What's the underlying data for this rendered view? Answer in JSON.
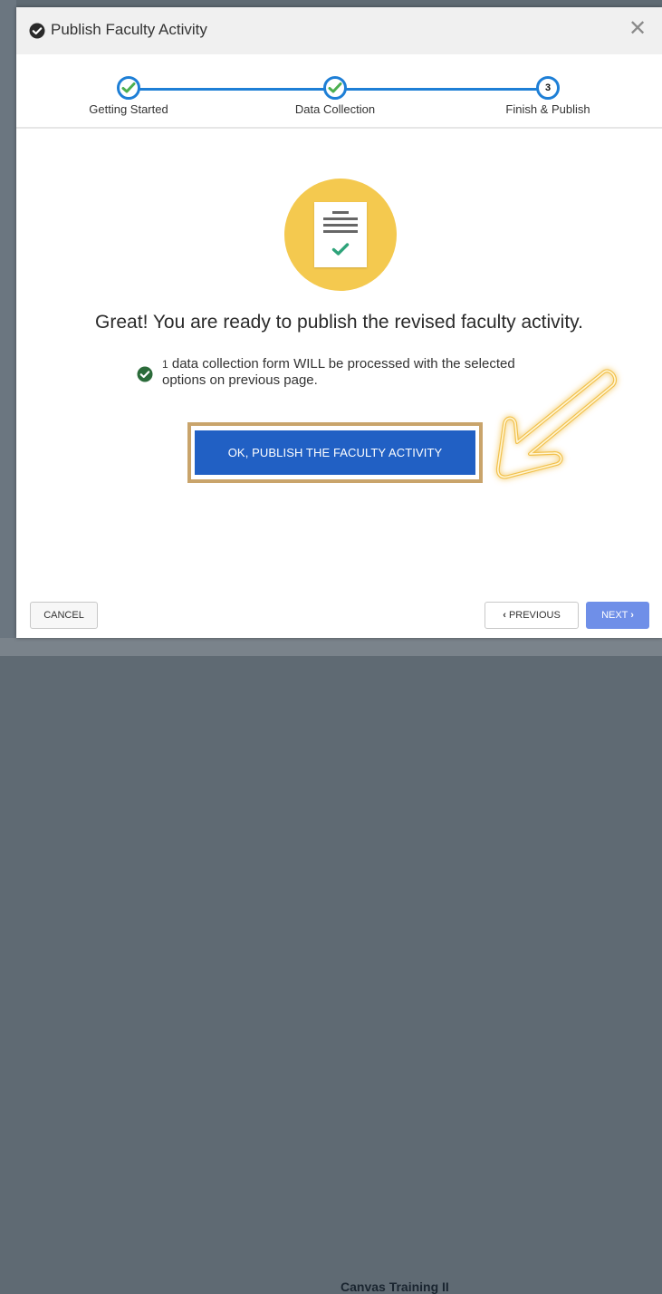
{
  "modal": {
    "title": "Publish Faculty Activity",
    "close_icon": "close-icon"
  },
  "stepper": {
    "steps": [
      {
        "label": "Getting Started",
        "status": "complete"
      },
      {
        "label": "Data Collection",
        "status": "complete"
      },
      {
        "label": "Finish & Publish",
        "status": "current",
        "number": "3"
      }
    ]
  },
  "content": {
    "headline": "Great! You are ready to publish the revised faculty activity.",
    "note_count": "1",
    "note_text": "data collection form  WILL be processed with the selected options on previous page.",
    "publish_label": "OK, PUBLISH THE FACULTY ACTIVITY"
  },
  "footer": {
    "cancel_label": "CANCEL",
    "previous_label": "PREVIOUS",
    "next_label": "NEXT"
  },
  "background": {
    "behind_text": "Canvas Training II"
  },
  "colors": {
    "primary": "#2160c4",
    "step_blue": "#1e7fd6",
    "check_green": "#2e9e5b",
    "highlight_gold": "#c9a46b",
    "hero_yellow": "#f4c94f"
  }
}
